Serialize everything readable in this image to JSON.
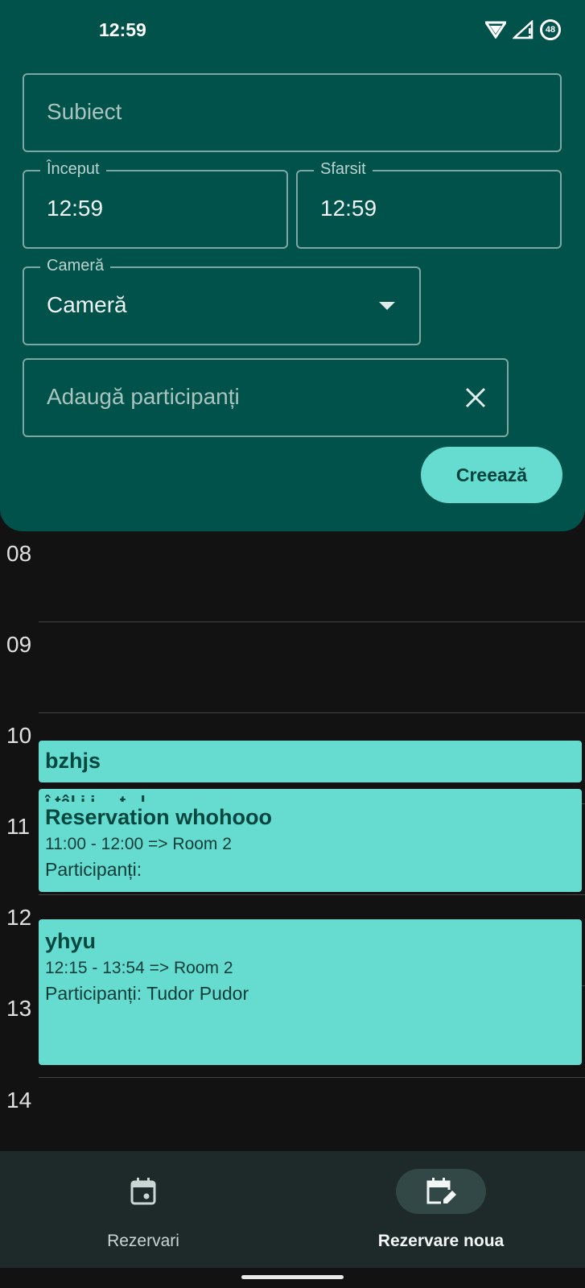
{
  "status_bar": {
    "time": "12:59",
    "battery": "48"
  },
  "form": {
    "subject_placeholder": "Subiect",
    "start": {
      "label": "Început",
      "value": "12:59"
    },
    "end": {
      "label": "Sfarsit",
      "value": "12:59"
    },
    "room": {
      "label": "Cameră",
      "value": "Cameră"
    },
    "participants_placeholder": "Adaugă participanți",
    "create_label": "Creează"
  },
  "calendar": {
    "hours": [
      "08",
      "09",
      "10",
      "11",
      "12",
      "13",
      "14"
    ],
    "events": [
      {
        "title": "bzhjs"
      },
      {
        "clipped_text": "î țâl i i . . t . l",
        "title": "Reservation whohooo",
        "time": "11:00 - 12:00 => Room 2",
        "participants": "Participanți:"
      },
      {
        "title": "yhyu",
        "time": "12:15 - 13:54 => Room 2",
        "participants": "Participanți: Tudor Pudor"
      }
    ]
  },
  "bottom_nav": {
    "items": [
      {
        "label": "Rezervari",
        "icon": "calendar-today-icon",
        "active": false
      },
      {
        "label": "Rezervare noua",
        "icon": "edit-calendar-icon",
        "active": true
      }
    ]
  },
  "colors": {
    "panel": "#00524a",
    "accent": "#66dbd0",
    "background": "#121212"
  }
}
